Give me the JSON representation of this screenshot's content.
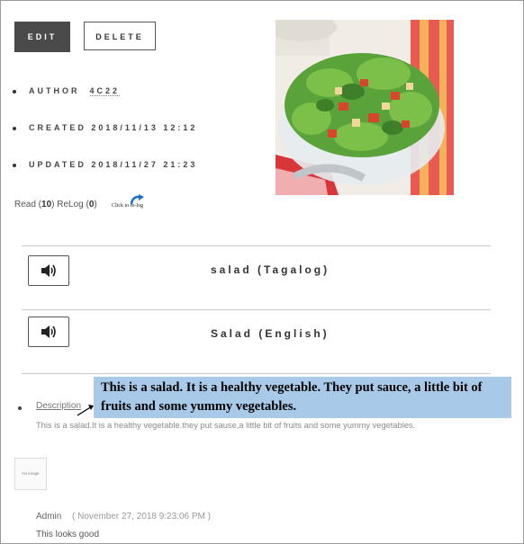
{
  "actions": {
    "edit_label": "EDIT",
    "delete_label": "DELETE"
  },
  "meta": {
    "author_label": "AUTHOR",
    "author_value": "4C22",
    "created_label": "CREATED",
    "created_value": "2018/11/13 12:12",
    "updated_label": "UPDATED",
    "updated_value": "2018/11/27 21:23"
  },
  "stats": {
    "read_label": "Read",
    "read_count": "10",
    "relog_label": "ReLog",
    "relog_count": "0",
    "relog_button": "Click to re-log"
  },
  "entries": [
    {
      "word": "salad (Tagalog)",
      "icon": "speaker-icon"
    },
    {
      "word": "Salad (English)",
      "icon": "speaker-icon"
    }
  ],
  "description": {
    "label": "Description",
    "callout": "This is a salad. It is a healthy vegetable. They put sauce, a little bit of fruits and some yummy vegetables.",
    "body": "This is a salad.It is a healthy vegetable.they put sause,a little bit of fruits and some yummy vegetables."
  },
  "comment": {
    "placeholder_image": "No image",
    "author": "Admin",
    "date": "( November 27, 2018 9:23:06 PM )",
    "text": "This looks good"
  },
  "colors": {
    "edit_bg": "#4a4a4a",
    "callout_bg": "#a9c9e9"
  }
}
